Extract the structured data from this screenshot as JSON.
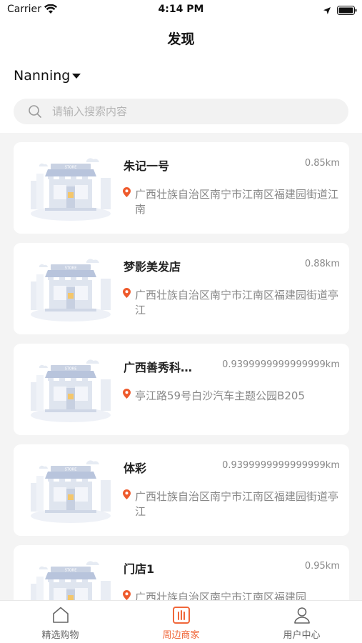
{
  "status": {
    "carrier": "Carrier",
    "time": "4:14 PM"
  },
  "nav": {
    "title": "发现"
  },
  "location": {
    "city": "Nanning"
  },
  "search": {
    "placeholder": "请输入搜索内容"
  },
  "stores": [
    {
      "name": "朱记一号",
      "distance": "0.85km",
      "address": "广西壮族自治区南宁市江南区福建园街道江南"
    },
    {
      "name": "梦影美发店",
      "distance": "0.88km",
      "address": "广西壮族自治区南宁市江南区福建园街道亭江"
    },
    {
      "name": "广西善秀科技有限公司",
      "distance": "0.9399999999999999km",
      "address": "亭江路59号白沙汽车主题公园B205"
    },
    {
      "name": "体彩",
      "distance": "0.9399999999999999km",
      "address": "广西壮族自治区南宁市江南区福建园街道亭江"
    },
    {
      "name": "门店1",
      "distance": "0.95km",
      "address": "广西壮族自治区南宁市江南区福建园"
    }
  ],
  "tabs": [
    {
      "label": "精选购物",
      "icon": "home-icon",
      "active": false
    },
    {
      "label": "周边商家",
      "icon": "nearby-store-icon",
      "active": true
    },
    {
      "label": "用户中心",
      "icon": "user-icon",
      "active": false
    }
  ],
  "colors": {
    "accent": "#f0673a",
    "pin": "#ee5a2c",
    "text_secondary": "#888888"
  }
}
